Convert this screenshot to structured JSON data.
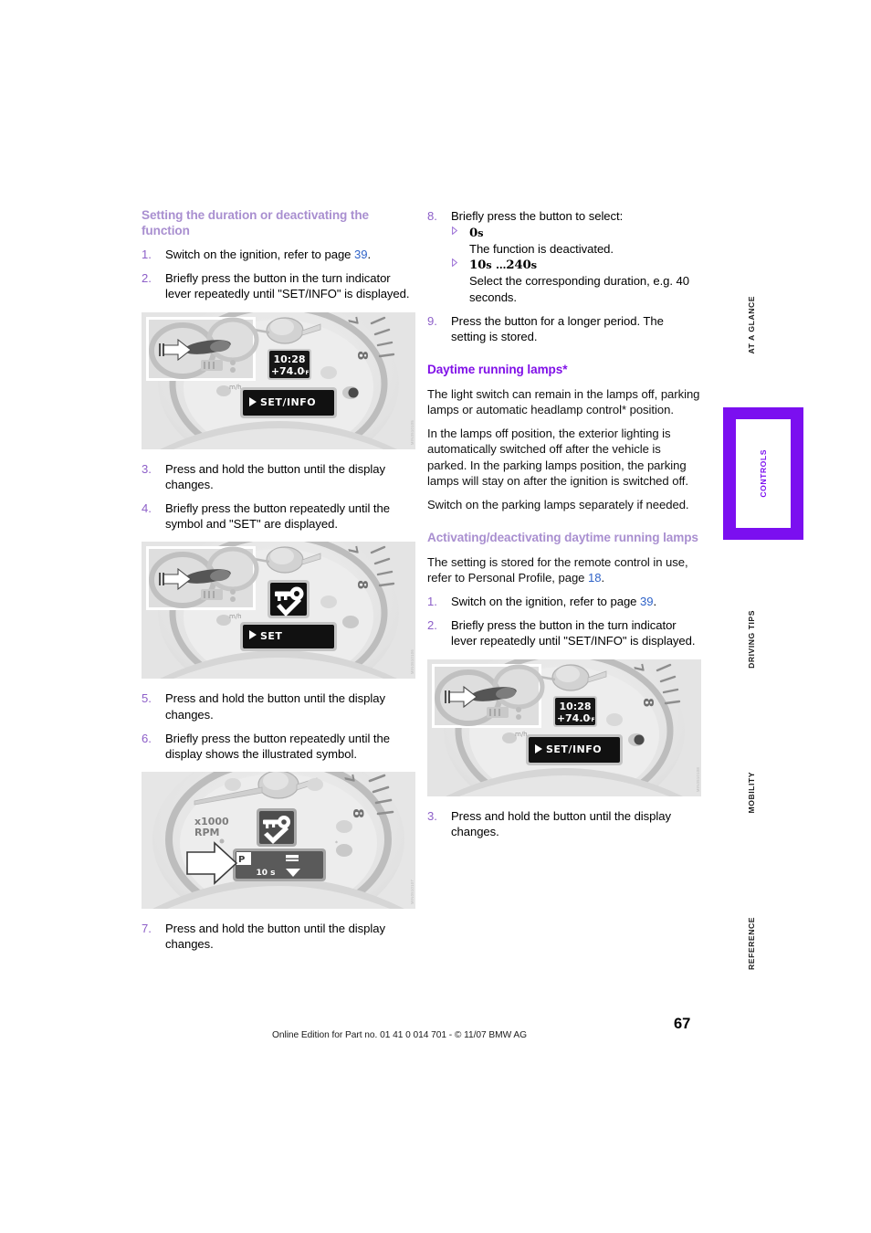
{
  "page": {
    "number": "67",
    "footer": "Online Edition for Part no. 01 41 0 014 701 - © 11/07 BMW AG"
  },
  "tabs": [
    {
      "label": "AT A GLANCE",
      "active": false
    },
    {
      "label": "CONTROLS",
      "active": true
    },
    {
      "label": "DRIVING TIPS",
      "active": false
    },
    {
      "label": "MOBILITY",
      "active": false
    },
    {
      "label": "REFERENCE",
      "active": false
    }
  ],
  "accent": {
    "tab_active_bg": "#7b0ff0",
    "heading_light": "#a98fd0",
    "heading_strong": "#8010e8",
    "step_number": "#8d5fc8",
    "page_reference": "#2f63c8"
  },
  "left_column": {
    "heading": "Setting the duration or deactivating the function",
    "step1_num": "1.",
    "step1_a": "Switch on the ignition, refer to page ",
    "step1_ref": "39",
    "step1_b": ".",
    "step2_num": "2.",
    "step2_text": "Briefly press the button in the turn indicator lever repeatedly until \"SET/INFO\" is displayed.",
    "step3_num": "3.",
    "step3_text": "Press and hold the button until the display changes.",
    "step4_num": "4.",
    "step4_text": "Briefly press the button repeatedly until the symbol and \"SET\" are displayed.",
    "step5_num": "5.",
    "step5_text": "Press and hold the button until the display changes.",
    "step6_num": "6.",
    "step6_text": "Briefly press the button repeatedly until the display shows the illustrated symbol.",
    "step7_num": "7.",
    "step7_text": "Press and hold the button until the display changes."
  },
  "right_column": {
    "step8_num": "8.",
    "step8_text": "Briefly press the button to select:",
    "sub1_value_num": "0",
    "sub1_value_unit": "s",
    "sub1_desc": "The function is deactivated.",
    "sub2_value_num": "10",
    "sub2_value_unit": "s",
    "sub2_ellipsis": "…",
    "sub2_value_num2": "240",
    "sub2_value_unit2": "s",
    "sub2_desc": "Select the corresponding duration, e.g. 40 seconds.",
    "step9_num": "9.",
    "step9_text": "Press the button for a longer period. The setting is stored.",
    "drl_heading": "Daytime running lamps*",
    "drl_para1": "The light switch can remain in the lamps off, parking lamps or automatic headlamp control* position.",
    "drl_para2": "In the lamps off position, the exterior lighting is automatically switched off after the vehicle is parked. In the parking lamps position, the parking lamps will stay on after the ignition is switched off.",
    "drl_para3": "Switch on the parking lamps separately if needed.",
    "act_heading": "Activating/deactivating daytime running lamps",
    "act_para_a": "The setting is stored for the remote control in use, refer to Personal Profile, page ",
    "act_para_ref": "18",
    "act_para_b": ".",
    "act_step1_num": "1.",
    "act_step1_a": "Switch on the ignition, refer to page ",
    "act_step1_ref": "39",
    "act_step1_b": ".",
    "act_step2_num": "2.",
    "act_step2_text": "Briefly press the button in the turn indicator lever repeatedly until \"SET/INFO\" is displayed.",
    "act_step3_num": "3.",
    "act_step3_text": "Press and hold the button until the display changes."
  },
  "figures": {
    "fig1": {
      "name": "instrument-cluster-setinfo",
      "lcd_time": "10:28",
      "lcd_temp": "+74.0",
      "lcd_temp_unit": "°F",
      "lcd_menu": "SET/INFO",
      "gauge_mark": "8",
      "code": "MIN0510105"
    },
    "fig2": {
      "name": "instrument-cluster-key-set",
      "lcd_menu": "SET",
      "gauge_mark": "8",
      "code": "MIN0510106"
    },
    "fig3": {
      "name": "instrument-cluster-duration",
      "gauge_unit_top": "x1000",
      "gauge_unit_bottom": "RPM",
      "lcd_duration": "10 s",
      "gauge_mark": "8",
      "code": "MIN0510107"
    },
    "fig4": {
      "name": "instrument-cluster-setinfo-2",
      "lcd_time": "10:28",
      "lcd_temp": "+74.0",
      "lcd_temp_unit": "°F",
      "lcd_menu": "SET/INFO",
      "gauge_mark": "8",
      "code": "MIN0510108"
    }
  }
}
